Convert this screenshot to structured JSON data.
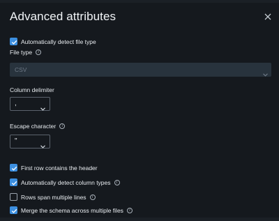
{
  "dialog": {
    "title": "Advanced attributes"
  },
  "auto_detect_file_type": {
    "label": "Automatically detect file type",
    "checked": true
  },
  "file_type": {
    "label": "File type",
    "value": "CSV",
    "disabled": true
  },
  "column_delimiter": {
    "label": "Column delimiter",
    "value": ","
  },
  "escape_character": {
    "label": "Escape character",
    "value": "\""
  },
  "options": [
    {
      "label": "First row contains the header",
      "checked": true,
      "info": false
    },
    {
      "label": "Automatically detect column types",
      "checked": true,
      "info": true
    },
    {
      "label": "Rows span multiple lines",
      "checked": false,
      "info": true
    },
    {
      "label": "Merge the schema across multiple files",
      "checked": true,
      "info": true
    }
  ],
  "colors": {
    "accent": "#3c8fe0",
    "background": "#15191e",
    "disabled_field": "#28333d"
  },
  "icons": {
    "close": "close-icon",
    "info": "info-icon",
    "chevron": "chevron-down-icon",
    "check": "check-icon"
  }
}
